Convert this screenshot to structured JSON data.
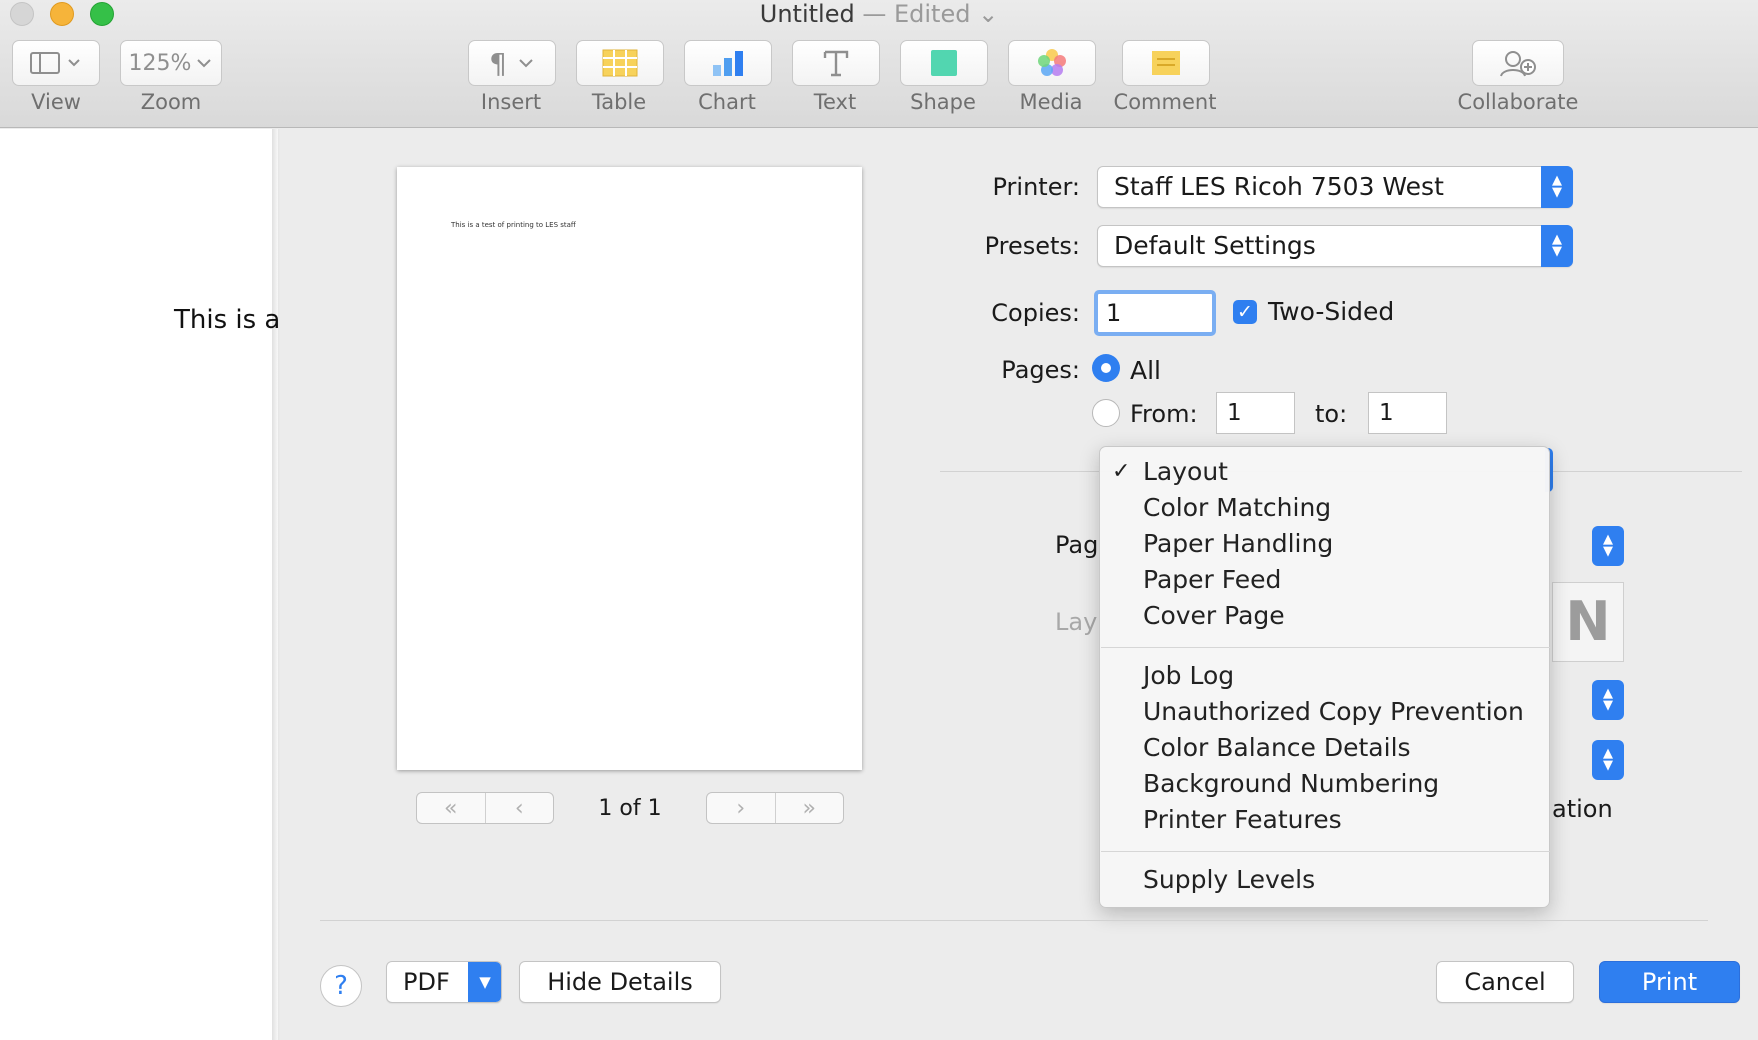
{
  "window": {
    "title": "Untitled",
    "title_sep": "—",
    "title_status": "Edited",
    "title_chevron": "⌄"
  },
  "toolbar": {
    "view": {
      "label": "View",
      "icon": "sidebar-icon"
    },
    "zoom": {
      "label": "Zoom",
      "value": "125%"
    },
    "insert": {
      "label": "Insert",
      "icon": "pilcrow-icon"
    },
    "table": {
      "label": "Table",
      "icon": "table-icon"
    },
    "chart": {
      "label": "Chart",
      "icon": "bar-chart-icon"
    },
    "text": {
      "label": "Text",
      "icon": "text-box-icon"
    },
    "shape": {
      "label": "Shape",
      "icon": "square-shape-icon"
    },
    "media": {
      "label": "Media",
      "icon": "photos-flower-icon"
    },
    "comment": {
      "label": "Comment",
      "icon": "sticky-note-icon"
    },
    "collaborate": {
      "label": "Collaborate",
      "icon": "add-person-icon"
    }
  },
  "document": {
    "visible_text": "This is a"
  },
  "preview": {
    "page_text": "This is a test of printing to LES staff",
    "page_count": "1 of 1"
  },
  "print": {
    "printer_label": "Printer:",
    "printer_value": "Staff LES Ricoh 7503 West",
    "presets_label": "Presets:",
    "presets_value": "Default Settings",
    "copies_label": "Copies:",
    "copies_value": "1",
    "two_sided_label": "Two-Sided",
    "two_sided_checked": true,
    "pages_label": "Pages:",
    "pages_all_label": "All",
    "pages_from_label": "From:",
    "pages_from_value": "1",
    "pages_to_label": "to:",
    "pages_to_value": "1",
    "obscured_pag": "Pag",
    "obscured_lay": "Lay",
    "obscured_ation": "ation"
  },
  "section_menu": {
    "selected": "Layout",
    "groups": [
      [
        "Layout",
        "Color Matching",
        "Paper Handling",
        "Paper Feed",
        "Cover Page"
      ],
      [
        "Job Log",
        "Unauthorized Copy Prevention",
        "Color Balance Details",
        "Background Numbering",
        "Printer Features"
      ],
      [
        "Supply Levels"
      ]
    ]
  },
  "buttons": {
    "help": "?",
    "pdf": "PDF",
    "hide_details": "Hide Details",
    "cancel": "Cancel",
    "print": "Print"
  },
  "colors": {
    "accent": "#2f7ff0",
    "toolbar_bg": "#e2e2e2",
    "sheet_bg": "#ececec"
  }
}
